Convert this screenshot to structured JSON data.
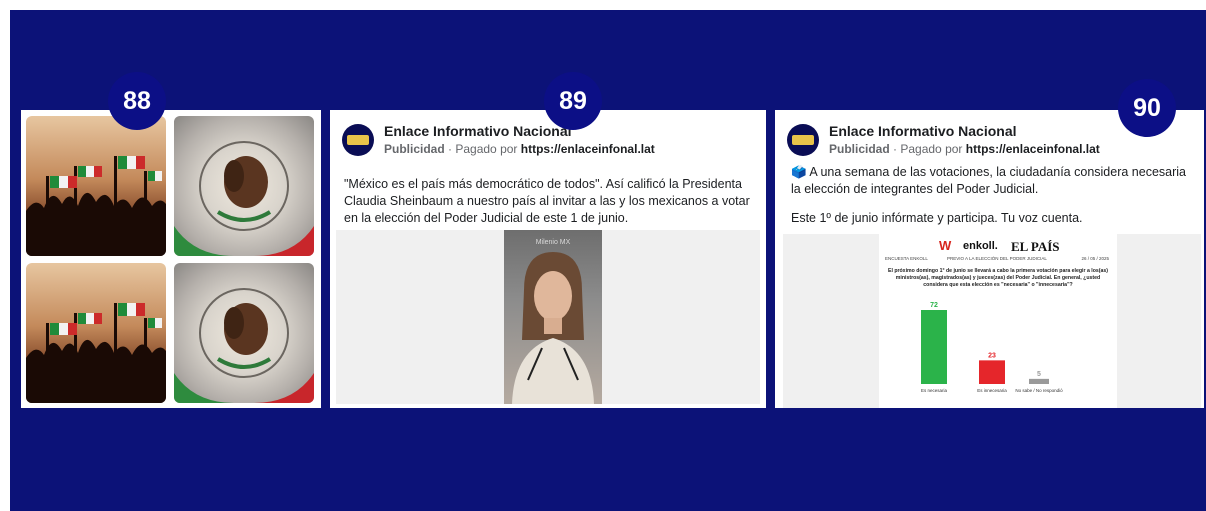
{
  "badges": {
    "b88": "88",
    "b89": "89",
    "b90": "90"
  },
  "post89": {
    "page_name": "Enlace Informativo Nacional",
    "sponsored": "Publicidad",
    "paid_by": "· Pagado por",
    "url": "https://enlaceinfonal.lat",
    "text": "\"México es el país más democrático de todos\". Así calificó la Presidenta Claudia Sheinbaum a nuestro país al invitar a las y los mexicanos a votar en la elección del Poder Judicial de este 1 de junio.",
    "media_label": "Milenio MX"
  },
  "post90": {
    "page_name": "Enlace Informativo Nacional",
    "sponsored": "Publicidad",
    "paid_by": "· Pagado por",
    "url": "https://enlaceinfonal.lat",
    "text1": "🗳️ A una semana de las votaciones, la ciudadanía considera necesaria la elección de integrantes del Poder Judicial.",
    "text2": "Este 1º de junio infórmate y participa. Tu voz cuenta.",
    "poll": {
      "logo_w": "W",
      "logo_enkoll": "enkoll.",
      "logo_elpais": "EL PAÍS",
      "sub_left": "ENCUESTA ENKOLL",
      "sub_mid": "PREVIO A LA ELECCIÓN DEL PODER JUDICIAL",
      "sub_date": "26 / 05 / 2025",
      "question": "El próximo domingo 1° de junio se llevará a cabo la primera votación para elegir a los(as) ministros(as), magistrados(as) y jueces(zas) del Poder Judicial. En general, ¿usted considera que esta elección es \"necesaria\" o \"innecesaria\"?"
    }
  },
  "chart_data": {
    "type": "bar",
    "categories": [
      "Es necesaria",
      "Es innecesaria",
      "No sabe / No respondió"
    ],
    "values": [
      72,
      23,
      5
    ],
    "colors": [
      "#2bb34a",
      "#e5262b",
      "#9a9a9a"
    ]
  }
}
